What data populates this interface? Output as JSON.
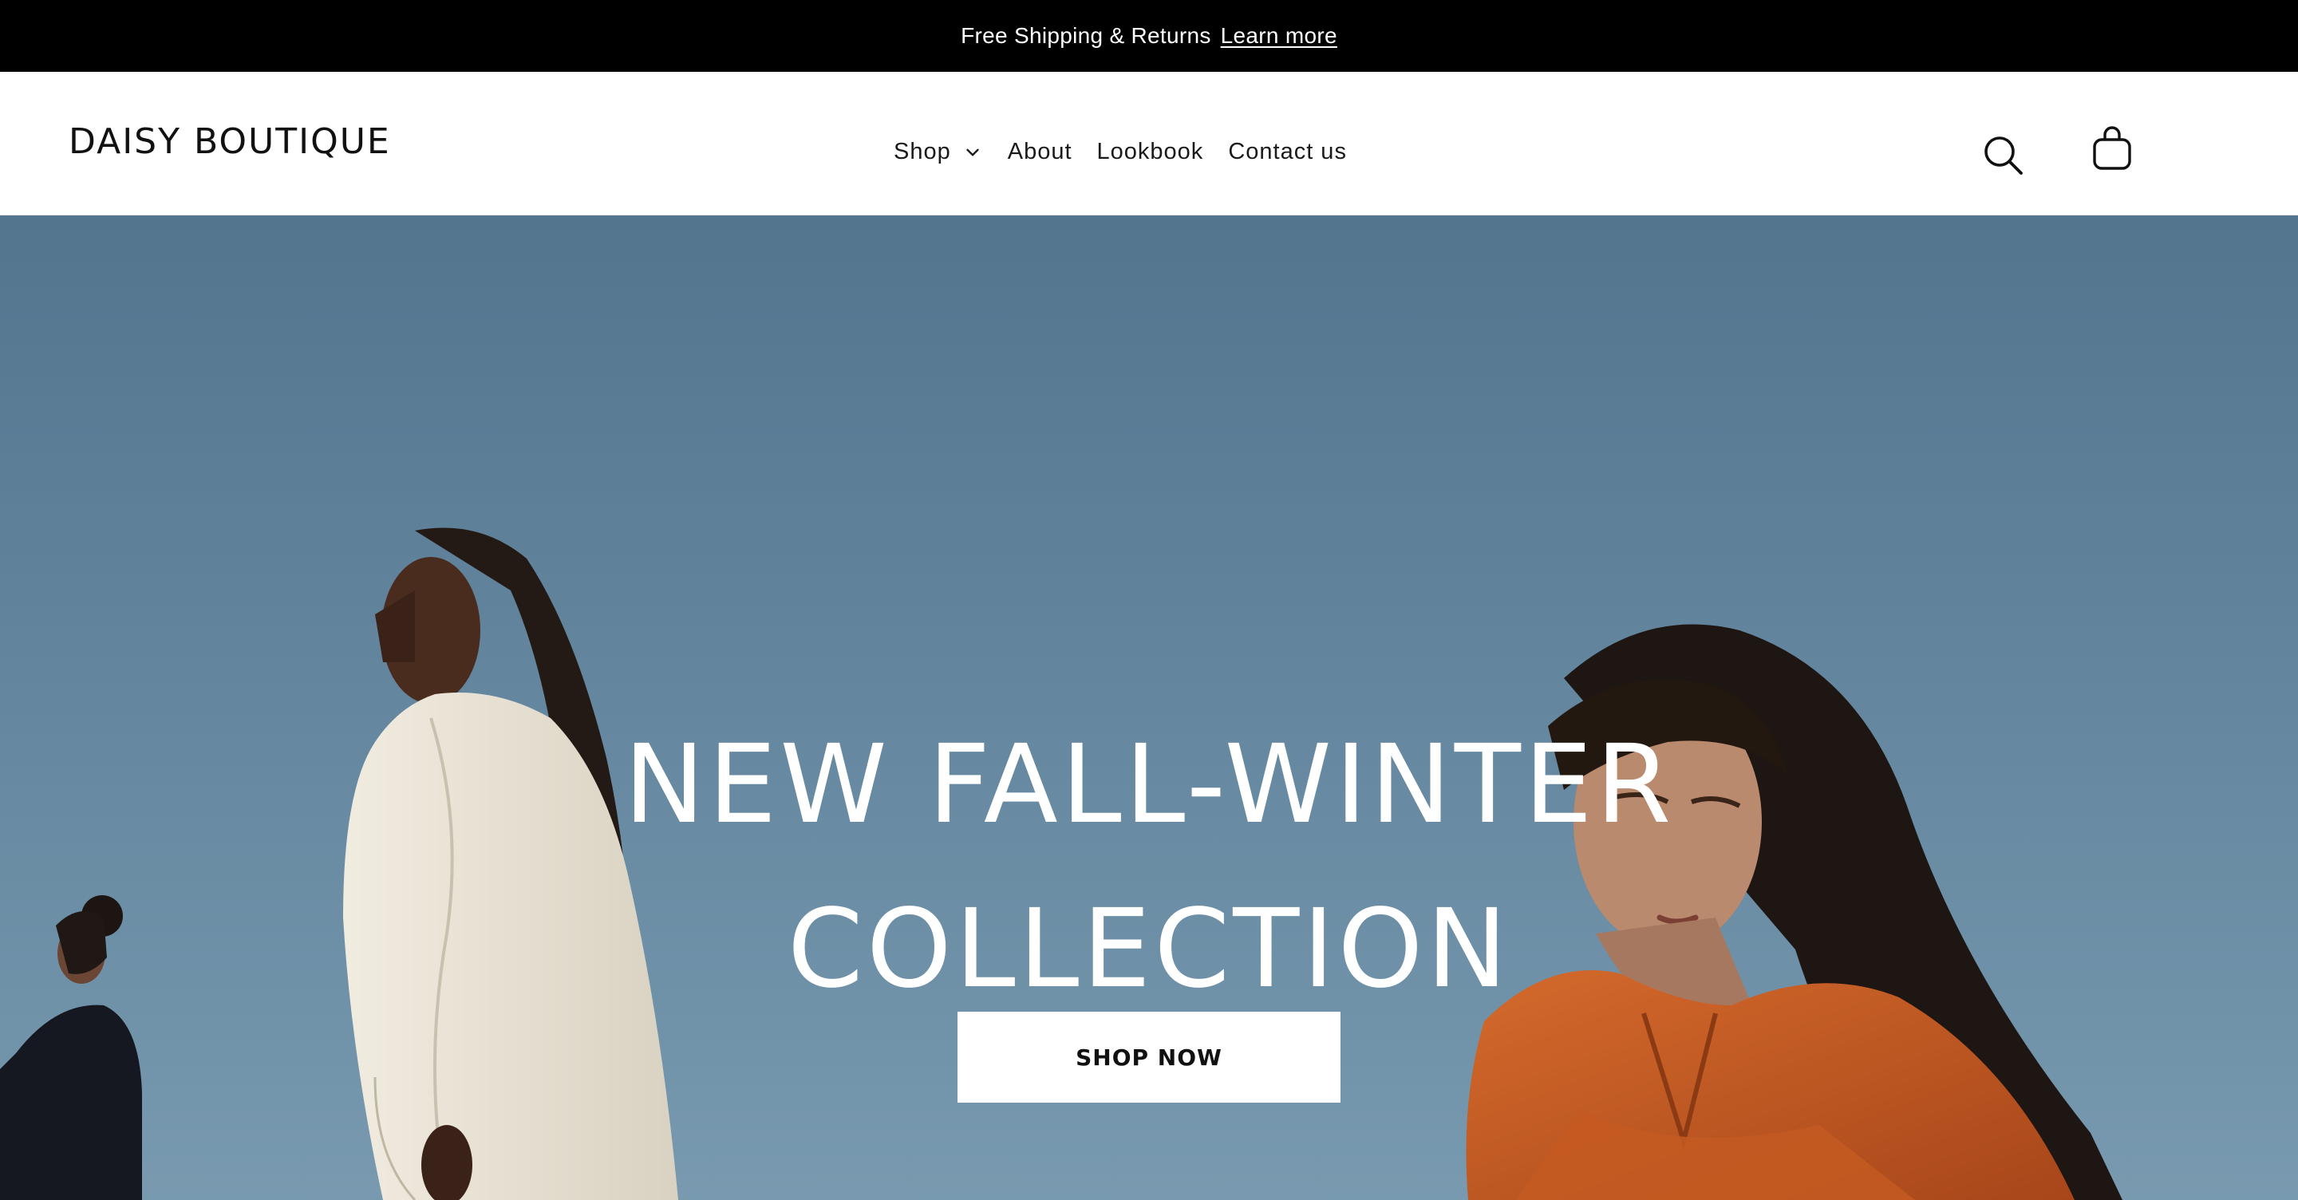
{
  "announcement": {
    "message": "Free Shipping & Returns",
    "link_label": "Learn more"
  },
  "header": {
    "logo": "DAISY BOUTIQUE",
    "nav": [
      {
        "label": "Shop",
        "has_dropdown": true
      },
      {
        "label": "About"
      },
      {
        "label": "Lookbook"
      },
      {
        "label": "Contact us"
      }
    ],
    "icons": [
      "search-icon",
      "shopping-bag-icon",
      "chevron-down-icon"
    ]
  },
  "hero": {
    "title_line_1": "NEW FALL-WINTER",
    "title_line_2": "COLLECTION",
    "cta_label": "SHOP NOW"
  },
  "colors": {
    "announcement_bg": "#000000",
    "header_bg": "#ffffff",
    "hero_sky": "#5f829b",
    "accent_orange": "#c4561c",
    "cream": "#ece6d8",
    "text_dark": "#111111"
  }
}
